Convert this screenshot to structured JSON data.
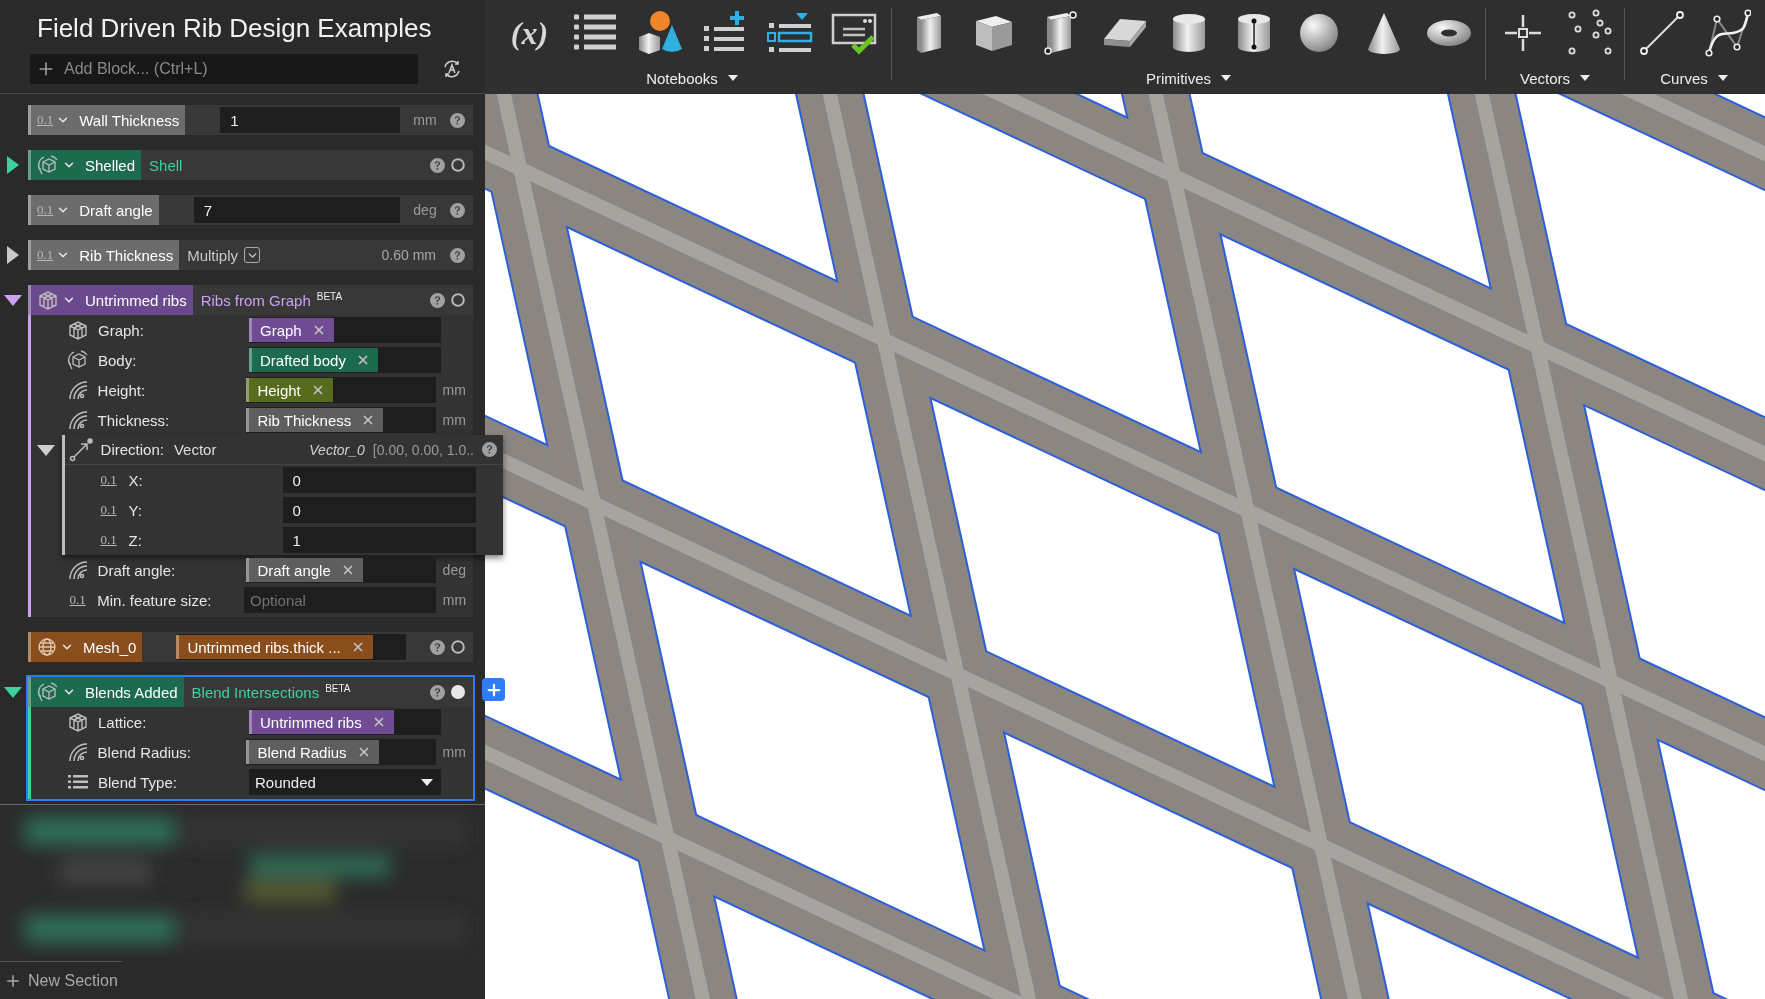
{
  "title": "Field Driven Rib Design Examples",
  "add_block": {
    "placeholder": "Add Block... (Ctrl+L)"
  },
  "blocks": [
    {
      "kind": "input",
      "prefix": "0.1",
      "name": "Wall Thickness",
      "color": "#6c6c6c",
      "value": "1",
      "unit": "mm",
      "selected": false
    },
    {
      "kind": "implicit",
      "name": "Shelled",
      "color": "#1d6b4f",
      "expanded": false,
      "operation": {
        "text": "Shell",
        "color": "#3fd19b"
      },
      "active": false,
      "selected": false
    },
    {
      "kind": "input",
      "prefix": "0.1",
      "name": "Draft angle",
      "color": "#6c6c6c",
      "value": "7",
      "unit": "deg",
      "selected": false
    },
    {
      "kind": "function",
      "prefix": "0.1",
      "name": "Rib Thickness",
      "color": "#6c6c6c",
      "expanded": false,
      "operation": {
        "text": "Multiply",
        "color": "#c8c8c8"
      },
      "value": "0.60 mm",
      "selected": false
    },
    {
      "kind": "lattice",
      "name": "Untrimmed ribs",
      "color": "#6a4a8c",
      "expanded": true,
      "operation": {
        "text": "Ribs from Graph",
        "color": "#c9a3f2"
      },
      "badge": "BETA",
      "active": false,
      "selected": false,
      "params": [
        {
          "kind": "lattice",
          "label": "Graph:",
          "chip": {
            "text": "Graph",
            "color": "#6f4c93"
          }
        },
        {
          "kind": "implicit",
          "label": "Body:",
          "chip": {
            "text": "Drafted body",
            "color": "#1d6b4f"
          }
        },
        {
          "kind": "field",
          "label": "Height:",
          "chip": {
            "text": "Height",
            "color": "#566b1d"
          },
          "unit": "mm"
        },
        {
          "kind": "field",
          "label": "Thickness:",
          "chip": {
            "text": "Rib Thickness",
            "color": "#5e5e5e"
          },
          "unit": "mm"
        },
        {
          "kind": "vector",
          "label": "Direction:",
          "type": "Vector",
          "reference": "Vector_0",
          "value": "[0.00, 0.00, 1.0..",
          "expanded": true,
          "children": [
            {
              "prefix": "0.1",
              "label": "X:",
              "value": "0"
            },
            {
              "prefix": "0.1",
              "label": "Y:",
              "value": "0"
            },
            {
              "prefix": "0.1",
              "label": "Z:",
              "value": "1"
            }
          ]
        },
        {
          "kind": "field",
          "label": "Draft angle:",
          "chip": {
            "text": "Draft angle",
            "color": "#5e5e5e"
          },
          "unit": "deg"
        },
        {
          "kind": "scalar",
          "prefix": "0.1",
          "label": "Min. feature size:",
          "placeholder": "Optional",
          "unit": "mm"
        }
      ]
    },
    {
      "kind": "reference",
      "name": "Mesh_0",
      "color": "#8a4d1c",
      "chip": {
        "text": "Untrimmed ribs.thick ...",
        "color": "#8a4d1c"
      },
      "active": false,
      "selected": false
    },
    {
      "kind": "implicit",
      "name": "Blends Added",
      "color": "#1d6b4f",
      "expanded": true,
      "operation": {
        "text": "Blend Intersections",
        "color": "#3fd19b"
      },
      "badge": "BETA",
      "active": true,
      "selected": true,
      "params": [
        {
          "kind": "lattice",
          "label": "Lattice:",
          "chip": {
            "text": "Untrimmed ribs",
            "color": "#6f4c93"
          }
        },
        {
          "kind": "field",
          "label": "Blend Radius:",
          "chip": {
            "text": "Blend Radius",
            "color": "#5e5e5e"
          },
          "unit": "mm"
        },
        {
          "kind": "choice",
          "label": "Blend Type:",
          "value": "Rounded"
        }
      ]
    }
  ],
  "new_section": {
    "label": "New Section"
  },
  "toolbar": [
    {
      "label": "Notebooks",
      "tools": [
        {
          "kind": "formula",
          "label": "(x)"
        },
        {
          "kind": "list"
        },
        {
          "kind": "shapes"
        },
        {
          "kind": "addlist"
        },
        {
          "kind": "picklist"
        },
        {
          "kind": "checkcard"
        }
      ]
    },
    {
      "label": "Primitives",
      "tools": [
        {
          "kind": "slab"
        },
        {
          "kind": "cube"
        },
        {
          "kind": "pointbox"
        },
        {
          "kind": "wedge"
        },
        {
          "kind": "cylinder"
        },
        {
          "kind": "axiscylinder"
        },
        {
          "kind": "sphere"
        },
        {
          "kind": "cone"
        },
        {
          "kind": "torus"
        }
      ]
    },
    {
      "label": "Vectors",
      "tools": [
        {
          "kind": "point"
        },
        {
          "kind": "cloud"
        }
      ]
    },
    {
      "label": "Curves",
      "tools": [
        {
          "kind": "line"
        },
        {
          "kind": "spline"
        }
      ]
    }
  ]
}
